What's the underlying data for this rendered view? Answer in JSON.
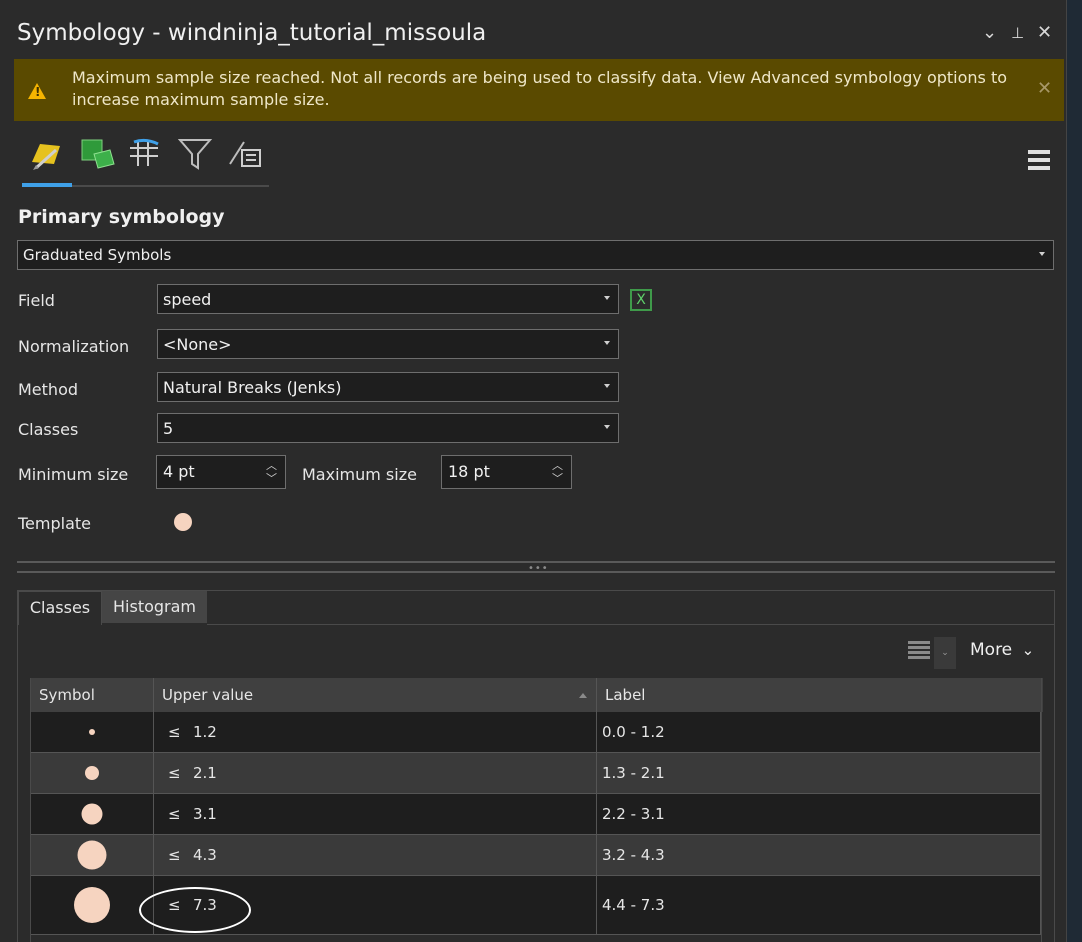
{
  "window": {
    "title": "Symbology - windninja_tutorial_missoula",
    "controls": {
      "dropdown": "⌄",
      "pin": "⊥",
      "close": "✕"
    }
  },
  "warning": {
    "message": "Maximum sample size reached. Not all records are being used to classify data. View Advanced symbology options to increase maximum sample size.",
    "icon_glyph": "!",
    "close": "✕",
    "colors": {
      "background": "#5a4a00",
      "icon": "#f5b400"
    }
  },
  "toolbar_tabs": [
    {
      "icon": "primary-symbology-icon",
      "active": true
    },
    {
      "icon": "vary-symbology-icon"
    },
    {
      "icon": "symbol-layer-drawing-icon"
    },
    {
      "icon": "symbol-filter-icon"
    },
    {
      "icon": "display-filters-icon"
    }
  ],
  "primary": {
    "heading": "Primary symbology",
    "type": "Graduated Symbols"
  },
  "form": {
    "field_label": "Field",
    "field_value": "speed",
    "normalization_label": "Normalization",
    "normalization_value": "<None>",
    "method_label": "Method",
    "method_value": "Natural Breaks (Jenks)",
    "classes_label": "Classes",
    "classes_value": "5",
    "min_size_label": "Minimum size",
    "min_size_value": "4 pt",
    "max_size_label": "Maximum size",
    "max_size_value": "18 pt",
    "template_label": "Template",
    "template_color": "#f6d4c0"
  },
  "class_tabs": {
    "classes": "Classes",
    "histogram": "Histogram",
    "active": "Classes"
  },
  "list_tools": {
    "more": "More",
    "more_chevron": "⌄"
  },
  "table": {
    "headers": {
      "symbol": "Symbol",
      "upper_value": "Upper value",
      "label": "Label"
    },
    "rows": [
      {
        "symbol_scale": 0.2,
        "prefix": "≤",
        "upper": "1.2",
        "label": "0.0 - 1.2"
      },
      {
        "symbol_scale": 0.4,
        "prefix": "≤",
        "upper": "2.1",
        "label": "1.3 - 2.1"
      },
      {
        "symbol_scale": 0.6,
        "prefix": "≤",
        "upper": "3.1",
        "label": "2.2 - 3.1"
      },
      {
        "symbol_scale": 0.8,
        "prefix": "≤",
        "upper": "4.3",
        "label": "3.2 - 4.3"
      },
      {
        "symbol_scale": 1.0,
        "prefix": "≤",
        "upper": "7.3",
        "label": "4.4 - 7.3",
        "highlighted": true
      }
    ]
  },
  "colors": {
    "accent": "#3fa0e8",
    "symbol_fill": "#f6d4c0",
    "panel_bg": "#2b2b2b"
  }
}
